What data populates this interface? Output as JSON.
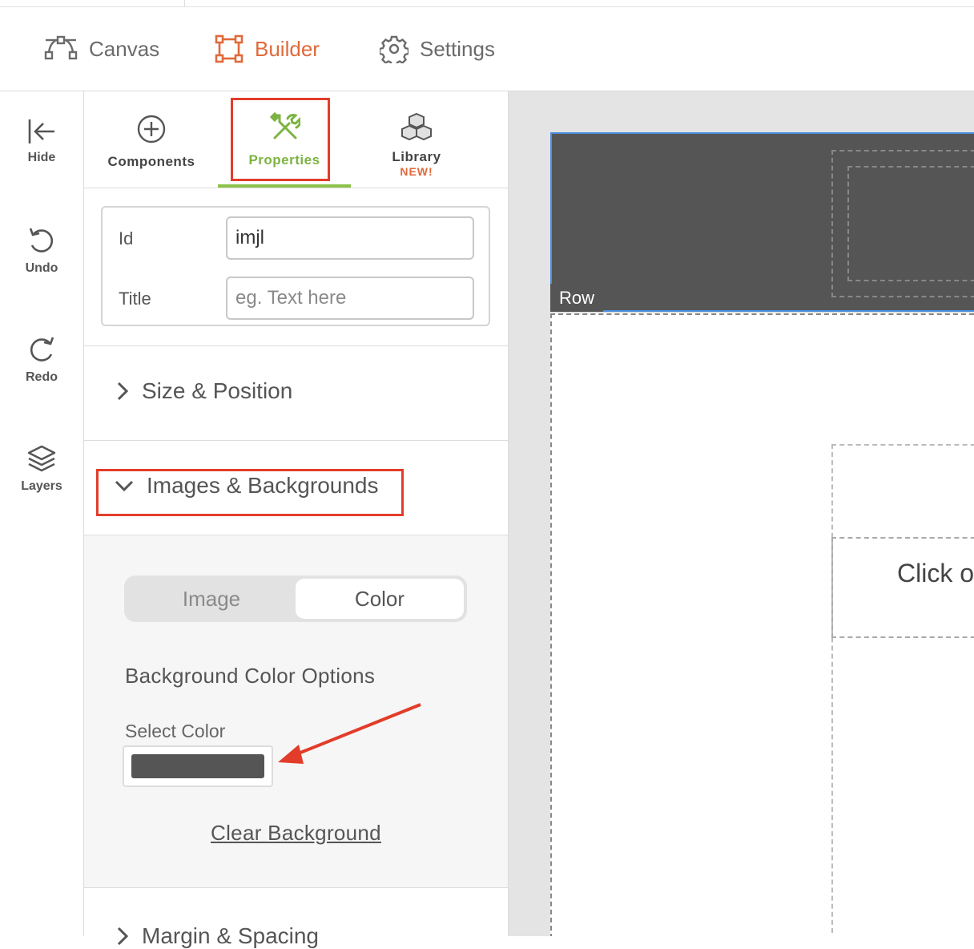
{
  "header": {
    "nav": [
      {
        "label": "Canvas",
        "icon": "bezier-curve-icon"
      },
      {
        "label": "Builder",
        "icon": "vector-square-icon",
        "active": true
      },
      {
        "label": "Settings",
        "icon": "gear-icon"
      }
    ]
  },
  "rail": {
    "items": [
      {
        "label": "Hide",
        "icon": "collapse-left-icon"
      },
      {
        "label": "Undo",
        "icon": "undo-icon"
      },
      {
        "label": "Redo",
        "icon": "redo-icon"
      },
      {
        "label": "Layers",
        "icon": "layers-icon"
      }
    ]
  },
  "panel": {
    "tabs": [
      {
        "label": "Components",
        "icon": "plus-circle-icon"
      },
      {
        "label": "Properties",
        "icon": "tools-icon",
        "active": true
      },
      {
        "label": "Library",
        "icon": "cubes-icon",
        "badge": "NEW!"
      }
    ],
    "fields": {
      "id_label": "Id",
      "id_value": "imjl",
      "title_label": "Title",
      "title_placeholder": "eg. Text here"
    },
    "sections": {
      "size_position": "Size & Position",
      "images_backgrounds": "Images & Backgrounds",
      "margin_spacing": "Margin & Spacing"
    },
    "background": {
      "toggle": {
        "image": "Image",
        "color": "Color",
        "selected": "Color"
      },
      "options_title": "Background Color Options",
      "select_color_label": "Select Color",
      "selected_color": "#555555",
      "clear_label": "Clear Background"
    }
  },
  "canvas": {
    "row_tag": "Row",
    "text_fragment": "Click o"
  },
  "colors": {
    "accent_orange": "#e06a3b",
    "accent_green": "#8bc34a",
    "highlight_red": "#e23d2a",
    "selection_blue": "#4a90e2"
  }
}
